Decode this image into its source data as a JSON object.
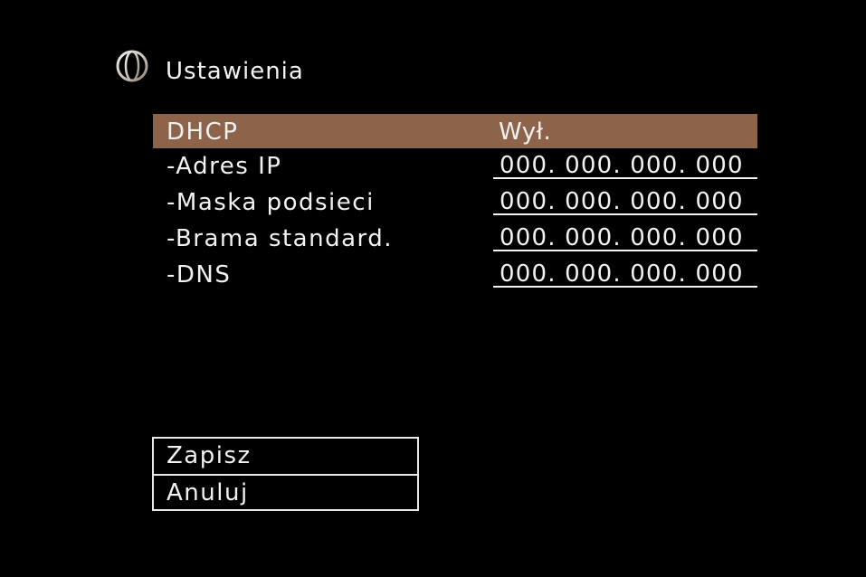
{
  "header": {
    "icon": "globe-network-icon",
    "title": "Ustawienia"
  },
  "colors": {
    "background": "#000000",
    "selected_row": "#8d634a",
    "text": "#f2f2f2",
    "icon": "#cfc7c0"
  },
  "settings": {
    "dhcp": {
      "label": "DHCP",
      "value": "Wył.",
      "selected": true
    },
    "ip_address": {
      "label": "-Adres IP",
      "value": "000. 000. 000. 000"
    },
    "subnet_mask": {
      "label": "-Maska podsieci",
      "value": "000. 000. 000. 000"
    },
    "default_gateway": {
      "label": "-Brama standard.",
      "value": "000. 000. 000. 000"
    },
    "dns": {
      "label": "-DNS",
      "value": "000. 000. 000. 000"
    }
  },
  "actions": {
    "save": "Zapisz",
    "cancel": "Anuluj"
  }
}
